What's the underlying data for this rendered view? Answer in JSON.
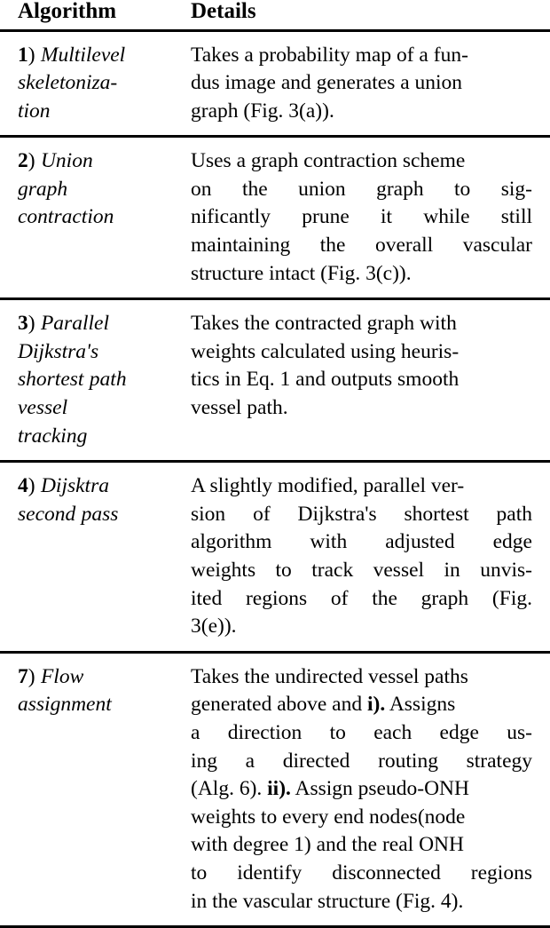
{
  "table": {
    "headers": {
      "algorithm": "Algorithm",
      "details": "Details"
    },
    "rows": [
      {
        "number": "1",
        "paren": ")",
        "name": "Multilevel skeletonization",
        "name_lines": [
          "Multilevel",
          "skeletoniza-",
          "tion"
        ],
        "details": "Takes a probability map of a fundus image and generates a union graph (Fig. 3(a)).",
        "details_lines": [
          {
            "justify": false,
            "words": [
              "Takes a probability map of a fun-"
            ]
          },
          {
            "justify": false,
            "words": [
              "dus image and generates a union"
            ]
          },
          {
            "justify": false,
            "words": [
              "graph (Fig. 3(a))."
            ]
          }
        ]
      },
      {
        "number": "2",
        "paren": ")",
        "name": "Union graph contraction",
        "name_lines": [
          "Union",
          "graph",
          "contraction"
        ],
        "details": "Uses a graph contraction scheme on the union graph to significantly prune it while still maintaining the overall vascular structure intact (Fig. 3(c)).",
        "details_lines": [
          {
            "justify": false,
            "words": [
              "Uses a graph contraction scheme"
            ]
          },
          {
            "justify": true,
            "words": [
              "on",
              "the",
              "union",
              "graph",
              "to",
              "sig-"
            ]
          },
          {
            "justify": true,
            "words": [
              "nificantly",
              "prune",
              "it",
              "while",
              "still"
            ]
          },
          {
            "justify": true,
            "words": [
              "maintaining",
              "the",
              "overall",
              "vascular"
            ]
          },
          {
            "justify": false,
            "words": [
              "structure intact (Fig. 3(c))."
            ]
          }
        ]
      },
      {
        "number": "3",
        "paren": ")",
        "name": "Parallel Dijkstra's shortest path vessel tracking",
        "name_lines": [
          "Parallel",
          "Dijkstra's",
          "shortest path",
          "vessel",
          "tracking"
        ],
        "details": "Takes the contracted graph with weights calculated using heuristics in Eq. 1 and outputs smooth vessel path.",
        "details_lines": [
          {
            "justify": false,
            "words": [
              "Takes the contracted graph with"
            ]
          },
          {
            "justify": false,
            "words": [
              "weights calculated using heuris-"
            ]
          },
          {
            "justify": false,
            "words": [
              "tics in Eq. 1 and outputs smooth"
            ]
          },
          {
            "justify": false,
            "words": [
              "vessel path."
            ]
          }
        ]
      },
      {
        "number": "4",
        "paren": ")",
        "name": "Dijsktra second pass",
        "name_lines": [
          "Dijsktra",
          "second pass"
        ],
        "details": "A slightly modified, parallel version of Dijkstra's shortest path algorithm with adjusted edge weights to track vessel in unvisited regions of the graph (Fig. 3(e)).",
        "details_lines": [
          {
            "justify": false,
            "words": [
              "A slightly modified, parallel ver-"
            ]
          },
          {
            "justify": true,
            "words": [
              "sion",
              "of",
              "Dijkstra's",
              "shortest",
              "path"
            ]
          },
          {
            "justify": true,
            "words": [
              "algorithm",
              "with",
              "adjusted",
              "edge"
            ]
          },
          {
            "justify": true,
            "words": [
              "weights",
              "to",
              "track",
              "vessel",
              "in",
              "unvis-"
            ]
          },
          {
            "justify": true,
            "words": [
              "ited",
              "regions",
              "of",
              "the",
              "graph",
              "(Fig."
            ]
          },
          {
            "justify": false,
            "words": [
              "3(e))."
            ]
          }
        ]
      },
      {
        "number": "7",
        "paren": ")",
        "name": "Flow assignment",
        "name_lines": [
          "Flow",
          "assignment"
        ],
        "details": "Takes the undirected vessel paths generated above and i). Assigns a direction to each edge using a directed routing strategy (Alg. 6). ii). Assign pseudo-ONH weights to every end nodes(node with degree 1) and the real ONH to identify disconnected regions in the vascular structure (Fig. 4).",
        "marker_one": "i).",
        "marker_two": "ii).",
        "details_lines": [
          {
            "justify": false,
            "words": [
              "Takes the undirected vessel paths"
            ]
          },
          {
            "justify": false,
            "bold_word": "i).",
            "pre": "generated above and ",
            "post": " Assigns"
          },
          {
            "justify": true,
            "words": [
              "a",
              "direction",
              "to",
              "each",
              "edge",
              "us-"
            ]
          },
          {
            "justify": true,
            "words": [
              "ing",
              "a",
              "directed",
              "routing",
              "strategy"
            ]
          },
          {
            "justify": false,
            "bold_word": "ii).",
            "pre": "(Alg. 6). ",
            "post": " Assign pseudo-ONH"
          },
          {
            "justify": false,
            "words": [
              "weights to every end nodes(node"
            ]
          },
          {
            "justify": false,
            "words": [
              "with degree 1) and the real ONH"
            ]
          },
          {
            "justify": true,
            "words": [
              "to",
              "identify",
              "disconnected",
              "regions"
            ]
          },
          {
            "justify": false,
            "words": [
              "in the vascular structure (Fig. 4)."
            ]
          }
        ]
      }
    ]
  }
}
